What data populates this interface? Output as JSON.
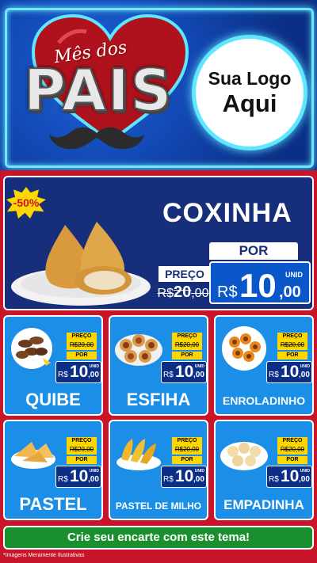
{
  "header": {
    "title_script": "Mês dos",
    "title_main": "PAIS",
    "logo_line1": "Sua Logo",
    "logo_line2": "Aqui"
  },
  "featured": {
    "badge": "-50%",
    "name": "COXINHA",
    "preco_label": "PREÇO",
    "old_currency": "R$",
    "old_int": "20",
    "old_cents": ",00",
    "por_label": "POR",
    "currency": "R$",
    "price_int": "10",
    "price_cents": ",00",
    "unit": "UNID"
  },
  "cards": [
    {
      "name": "QUIBE",
      "preco": "PREÇO",
      "old": "R$20,00",
      "por": "POR",
      "currency": "R$",
      "int": "10",
      "cents": ",00",
      "unit": "UNID"
    },
    {
      "name": "ESFIHA",
      "preco": "PREÇO",
      "old": "R$20,00",
      "por": "POR",
      "currency": "R$",
      "int": "10",
      "cents": ",00",
      "unit": "UNID"
    },
    {
      "name": "ENROLADINHO",
      "preco": "PREÇO",
      "old": "R$20,00",
      "por": "POR",
      "currency": "R$",
      "int": "10",
      "cents": ",00",
      "unit": "UNID"
    },
    {
      "name": "PASTEL",
      "preco": "PREÇO",
      "old": "R$20,00",
      "por": "POR",
      "currency": "R$",
      "int": "10",
      "cents": ",00",
      "unit": "UNID"
    },
    {
      "name": "PASTEL DE MILHO",
      "preco": "PREÇO",
      "old": "R$20,00",
      "por": "POR",
      "currency": "R$",
      "int": "10",
      "cents": ",00",
      "unit": "UNID"
    },
    {
      "name": "EMPADINHA",
      "preco": "PREÇO",
      "old": "R$20,00",
      "por": "POR",
      "currency": "R$",
      "int": "10",
      "cents": ",00",
      "unit": "UNID"
    }
  ],
  "footer": {
    "cta": "Crie seu encarte com este tema!",
    "disclaimer": "*Imagens Meramente Ilustrativas"
  },
  "colors": {
    "header_blue": "#134bb8",
    "neon": "#5fe7ff",
    "red": "#c8152a",
    "card_blue": "#1b8ee8",
    "price_yellow": "#ffd700",
    "cta_green": "#1a8f2e"
  }
}
